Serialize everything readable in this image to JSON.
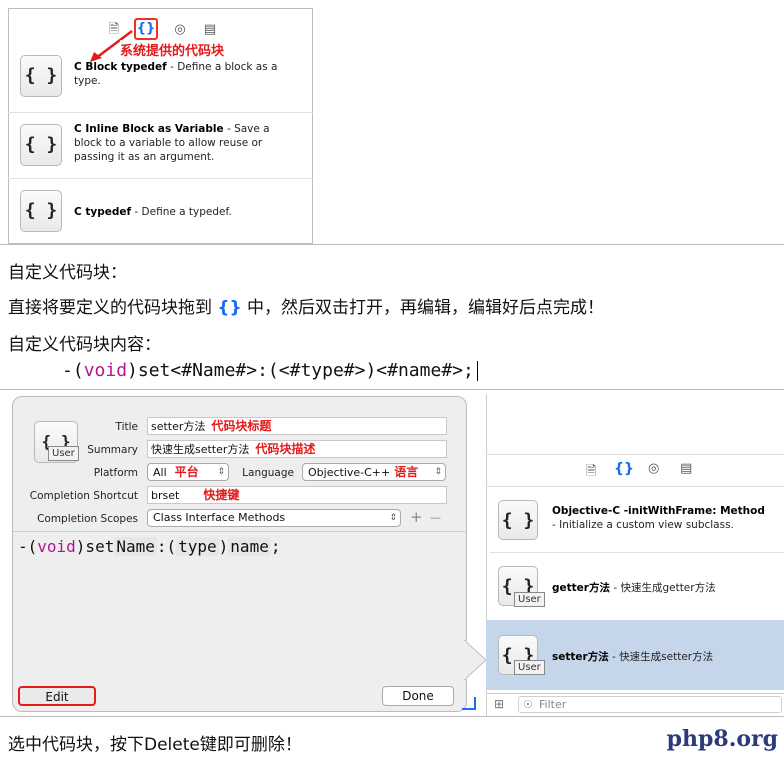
{
  "top_panel": {
    "tabs": [
      "file-icon",
      "braces-icon",
      "object-icon",
      "media-icon"
    ],
    "annotation": "系统提供的代码块",
    "items": [
      {
        "name": "C Block typedef",
        "desc": " - Define a block as a type."
      },
      {
        "name": "C Inline Block as Variable",
        "desc": " - Save a block to a variable to allow reuse or passing it as an argument."
      },
      {
        "name": "C typedef",
        "desc": " - Define a typedef."
      }
    ]
  },
  "instructions": {
    "line1": "自定义代码块：",
    "line2_pre": "直接将要定义的代码块拖到 ",
    "line2_brace": "{}",
    "line2_post": " 中，然后双击打开，再编辑，编辑好后点完成！",
    "line3": "自定义代码块内容：",
    "code_open": "-(",
    "code_kw": "void",
    "code_rest": ")set<#Name#>:(<#type#>)<#name#>;"
  },
  "editor": {
    "user_badge": "User",
    "labels": {
      "title": "Title",
      "summary": "Summary",
      "platform": "Platform",
      "language": "Language",
      "shortcut": "Completion Shortcut",
      "scopes": "Completion Scopes"
    },
    "values": {
      "title": "setter方法",
      "summary": "快速生成setter方法",
      "platform": "All",
      "language": "Objective-C++",
      "shortcut": "brset",
      "scopes": "Class Interface Methods"
    },
    "tags": {
      "title": "代码块标题",
      "summary": "代码块描述",
      "platform": "平台",
      "language": "语言",
      "shortcut": "快捷键"
    },
    "code": {
      "prefix": "-(",
      "kw": "void",
      "mid": ")set",
      "tok_name": "Name",
      "colon": ":(",
      "tok_type": "type",
      "close": ")",
      "tok_arg": "name",
      "end": ";"
    },
    "edit_button": "Edit",
    "done_button": "Done",
    "add": "+",
    "remove": "—"
  },
  "right_panel": {
    "items": [
      {
        "name": "Objective-C -initWithFrame: Method",
        "desc": "- Initialize a custom view subclass."
      },
      {
        "name": "getter方法",
        "desc": " - 快速生成getter方法"
      },
      {
        "name": "setter方法",
        "desc": " - 快速生成setter方法"
      }
    ],
    "filter_placeholder": "Filter",
    "user_badge": "User"
  },
  "footer": "选中代码块，按下Delete键即可删除！",
  "watermark": "php8.org"
}
